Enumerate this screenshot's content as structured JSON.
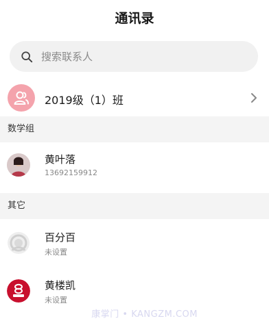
{
  "header": {
    "title": "通讯录"
  },
  "search": {
    "placeholder": "搜索联系人"
  },
  "class_group": {
    "label": "2019级（1）班"
  },
  "sections": [
    {
      "title": "数学组",
      "contacts": [
        {
          "name": "黄叶落",
          "subtitle": "13692159912",
          "avatar": "photo-avatar"
        }
      ]
    },
    {
      "title": "其它",
      "contacts": [
        {
          "name": "百分百",
          "subtitle": "未设置",
          "avatar": "default-gray-avatar"
        },
        {
          "name": "黄楼凯",
          "subtitle": "未设置",
          "avatar": "red-logo-avatar"
        }
      ]
    }
  ],
  "watermark": "康掌门 • KANGZM.COM",
  "colors": {
    "class_avatar_bg": "#f4a3ac",
    "section_bg": "#f4f4f4",
    "search_bg": "#f1f1f1"
  }
}
